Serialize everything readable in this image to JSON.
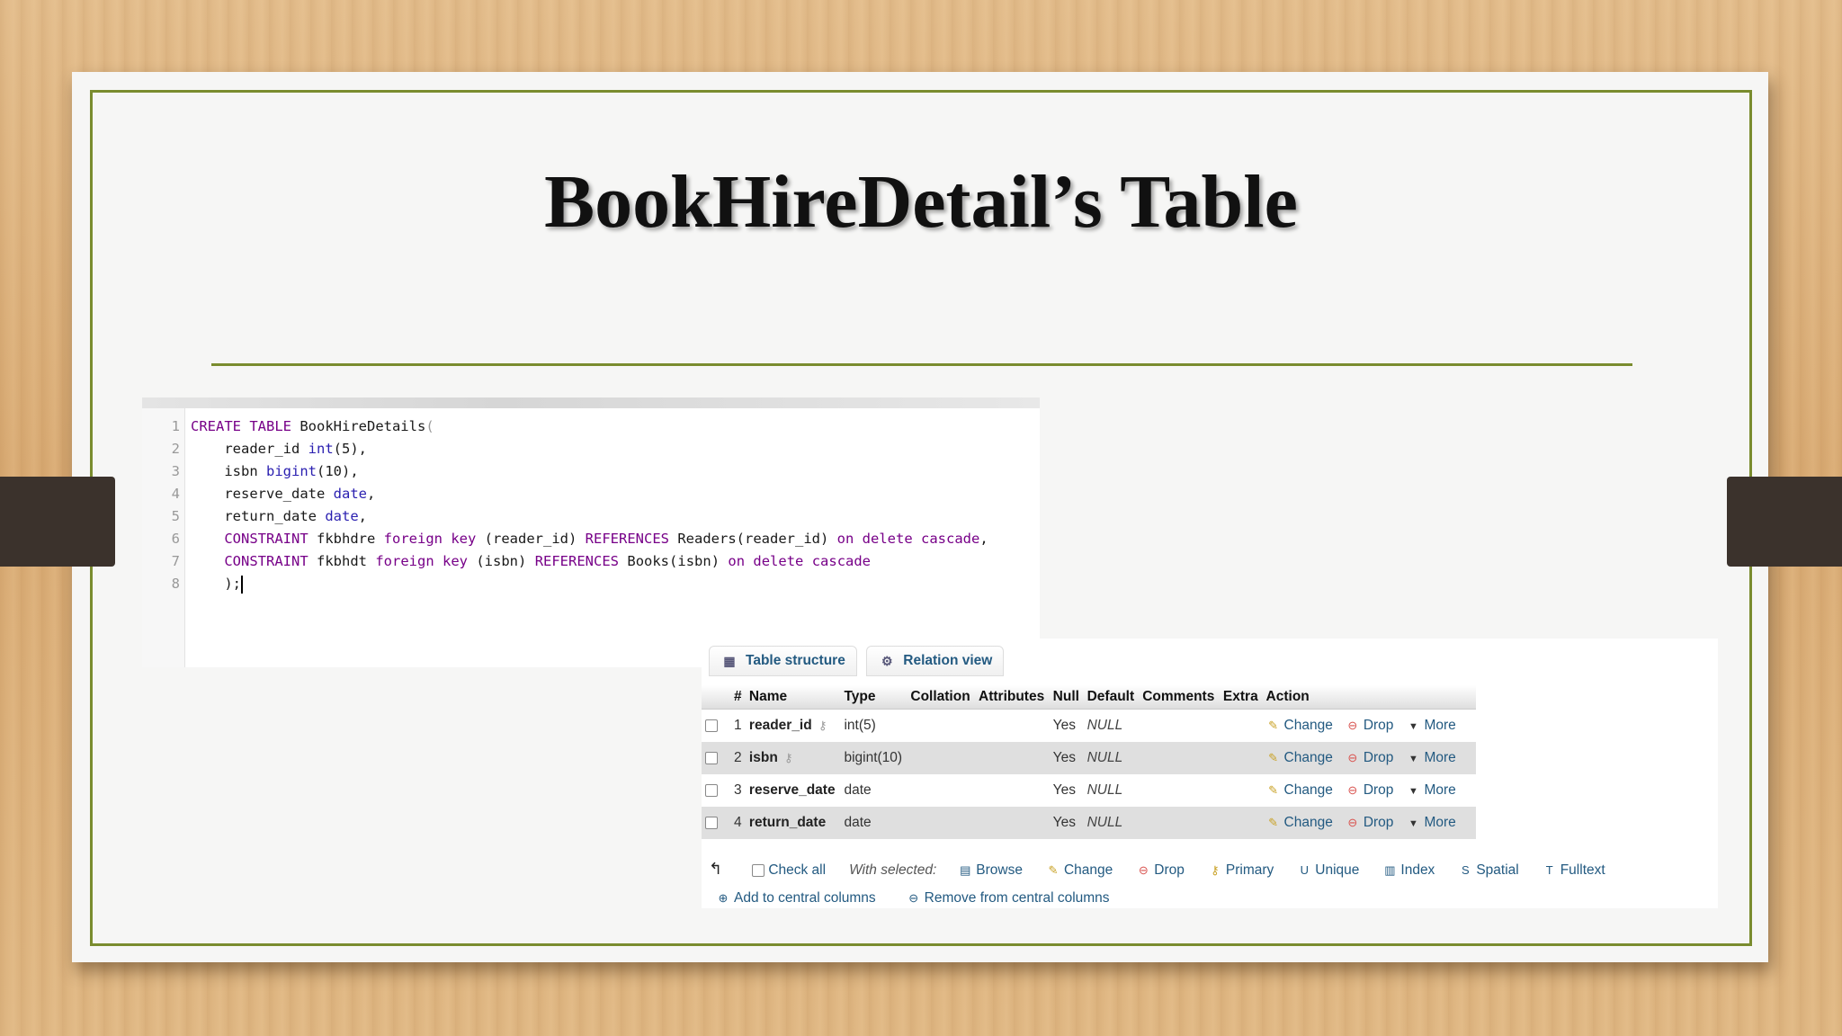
{
  "slide_title": "BookHireDetail’s Table",
  "code": {
    "lines": [
      {
        "n": "1"
      },
      {
        "n": "2"
      },
      {
        "n": "3"
      },
      {
        "n": "4"
      },
      {
        "n": "5"
      },
      {
        "n": "6"
      },
      {
        "n": "7"
      },
      {
        "n": "8"
      }
    ],
    "text": {
      "create": "CREATE TABLE",
      "table_name": "BookHireDetails",
      "lp": "(",
      "reader_id": "reader_id",
      "int": "int",
      "five": "(5)",
      "isbn": "isbn",
      "bigint": "bigint",
      "ten": "(10)",
      "reserve_date": "reserve_date",
      "return_date": "return_date",
      "date": "date",
      "comma": ",",
      "constraint": "CONSTRAINT",
      "fk1": "fkbhdre",
      "fk2": "fkbhdt",
      "foreign_key": "foreign key",
      "ref_reader": "(reader_id)",
      "ref_isbn": "(isbn)",
      "references": "REFERENCES",
      "readers": "Readers",
      "books": "Books",
      "on_delete_cascade": "on delete cascade",
      "close": ");"
    }
  },
  "pma": {
    "tabs": [
      {
        "label": "Table structure"
      },
      {
        "label": "Relation view"
      }
    ],
    "headers": [
      "#",
      "Name",
      "Type",
      "Collation",
      "Attributes",
      "Null",
      "Default",
      "Comments",
      "Extra",
      "Action"
    ],
    "rows": [
      {
        "num": "1",
        "name": "reader_id",
        "type": "int(5)",
        "null": "Yes",
        "default": "NULL"
      },
      {
        "num": "2",
        "name": "isbn",
        "type": "bigint(10)",
        "null": "Yes",
        "default": "NULL"
      },
      {
        "num": "3",
        "name": "reserve_date",
        "type": "date",
        "null": "Yes",
        "default": "NULL"
      },
      {
        "num": "4",
        "name": "return_date",
        "type": "date",
        "null": "Yes",
        "default": "NULL"
      }
    ],
    "row_actions": {
      "change": "Change",
      "drop": "Drop",
      "more": "More"
    },
    "bulk": {
      "check_all": "Check all",
      "with_selected": "With selected:",
      "browse": "Browse",
      "change": "Change",
      "drop": "Drop",
      "primary": "Primary",
      "unique": "Unique",
      "index": "Index",
      "spatial": "Spatial",
      "fulltext": "Fulltext"
    },
    "central": {
      "add": "Add to central columns",
      "remove": "Remove from central columns"
    }
  },
  "colors": {
    "frame": "#7a8c2e",
    "link": "#235a81",
    "keyword": "#770088",
    "type": "#2a1fb0"
  }
}
